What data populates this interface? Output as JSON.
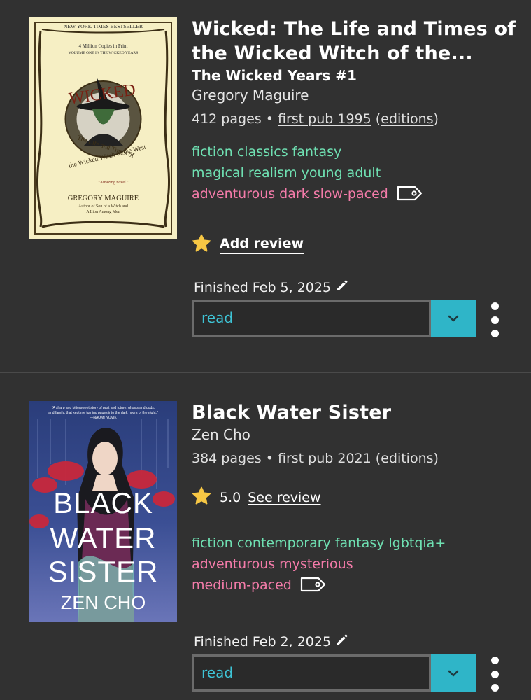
{
  "books": [
    {
      "title": "Wicked: The Life and Times of the Wicked Witch of the...",
      "series": "The Wicked Years #1",
      "author": "Gregory Maguire",
      "pages": "412 pages",
      "bullet": "•",
      "first_pub": "first pub 1995",
      "paren_open": "(",
      "editions": "editions",
      "paren_close": ")",
      "genre_tags_1": "fiction classics fantasy",
      "genre_tags_2": "magical realism young adult",
      "mood_tags": "adventurous dark slow-paced",
      "add_review": "Add review",
      "finished": "Finished Feb 5, 2025",
      "shelf_value": "read",
      "cover": {
        "banner": "NEW YORK TIMES BESTSELLER",
        "copies": "4 Million Copies in Print",
        "volume": "VOLUME ONE IN THE WICKED YEARS",
        "big_title": "WICKED",
        "subtitle_1": "The Life and Times of",
        "subtitle_2": "the Wicked Witch of the West",
        "quote": "\"Amazing novel.\"",
        "author": "GREGORY MAGUIRE",
        "author_note_1": "Author of Son of a Witch and",
        "author_note_2": "A Lion Among Men"
      }
    },
    {
      "title": "Black Water Sister",
      "author": "Zen Cho",
      "pages": "384 pages",
      "bullet": "•",
      "first_pub": "first pub 2021",
      "paren_open": "(",
      "editions": "editions",
      "paren_close": ")",
      "rating": "5.0",
      "see_review": "See review",
      "genre_tags_1": "fiction contemporary fantasy lgbtqia+",
      "mood_tags_1": "adventurous mysterious",
      "mood_tags_2": "medium-paced",
      "finished": "Finished Feb 2, 2025",
      "shelf_value": "read",
      "cover": {
        "blurb_1": "\"A sharp and bittersweet story of past and future, ghosts and gods,",
        "blurb_2": "and family, that kept me turning pages into the dark hours of the night.\"",
        "blurb_3": "—NAOMI NOVIK",
        "word_1": "BLACK",
        "word_2": "WATER",
        "word_3": "SISTER",
        "author": "ZEN CHO"
      }
    }
  ],
  "colors": {
    "background": "#313131",
    "genre_tag": "#6fe0b2",
    "mood_tag": "#f37ba9",
    "accent": "#2fb5c8",
    "star": "#f7c744"
  },
  "icons": [
    "star-icon",
    "tag-icon",
    "pencil-icon",
    "chevron-down-icon",
    "more-options-icon"
  ]
}
